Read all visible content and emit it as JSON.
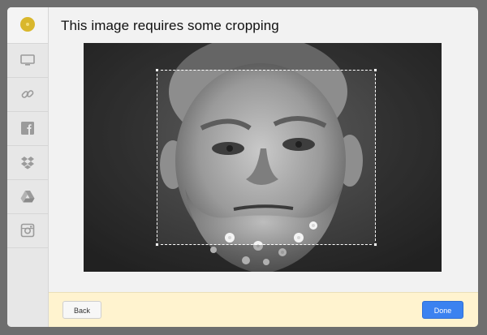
{
  "dialog": {
    "title": "This image requires some cropping"
  },
  "sidebar": {
    "logo_icon": "yellow-circle-logo",
    "items": [
      {
        "icon": "monitor-icon",
        "name": "computer"
      },
      {
        "icon": "link-icon",
        "name": "link"
      },
      {
        "icon": "facebook-icon",
        "name": "facebook"
      },
      {
        "icon": "dropbox-icon",
        "name": "dropbox"
      },
      {
        "icon": "google-drive-icon",
        "name": "google-drive"
      },
      {
        "icon": "instagram-icon",
        "name": "instagram"
      }
    ]
  },
  "image": {
    "description_icon": "black-and-white-portrait-photo"
  },
  "footer": {
    "back_label": "Back",
    "done_label": "Done"
  },
  "colors": {
    "primary": "#3b82f0",
    "footer_bg": "#fff3cf",
    "logo": "#d9b72c"
  }
}
